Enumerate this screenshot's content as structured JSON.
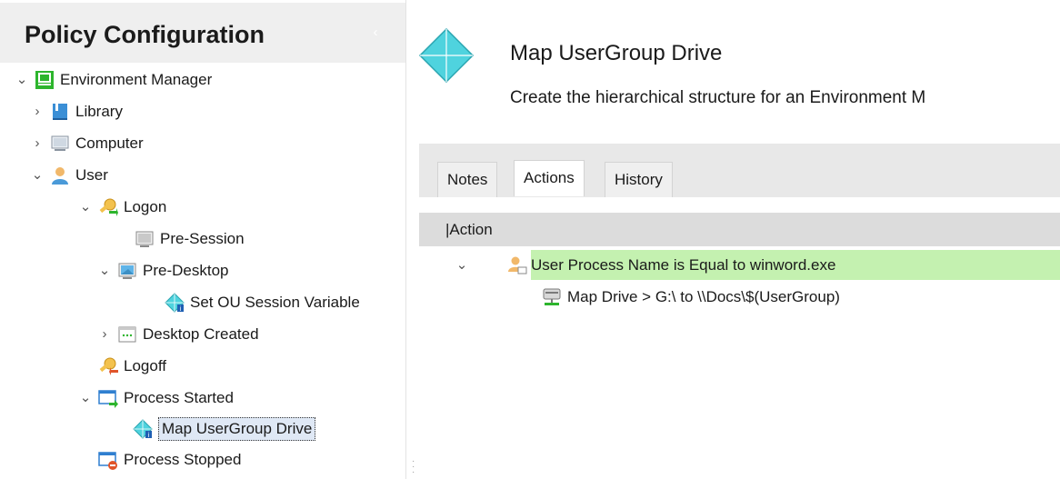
{
  "left_panel": {
    "title": "Policy Configuration",
    "collapse_glyph": "‹",
    "tree": [
      {
        "label": "Environment Manager",
        "icon": "environment-manager-icon",
        "expander": "expanded"
      },
      {
        "label": "Library",
        "icon": "library-icon",
        "expander": "collapsed"
      },
      {
        "label": "Computer",
        "icon": "computer-icon",
        "expander": "collapsed"
      },
      {
        "label": "User",
        "icon": "user-icon",
        "expander": "expanded"
      },
      {
        "label": "Logon",
        "icon": "logon-key-icon",
        "expander": "expanded"
      },
      {
        "label": "Pre-Session",
        "icon": "pre-session-icon",
        "expander": "none"
      },
      {
        "label": "Pre-Desktop",
        "icon": "pre-desktop-icon",
        "expander": "expanded"
      },
      {
        "label": "Set OU Session Variable",
        "icon": "policy-node-icon",
        "expander": "none"
      },
      {
        "label": "Desktop Created",
        "icon": "desktop-created-icon",
        "expander": "collapsed"
      },
      {
        "label": "Logoff",
        "icon": "logoff-key-icon",
        "expander": "none"
      },
      {
        "label": "Process Started",
        "icon": "process-started-icon",
        "expander": "expanded"
      },
      {
        "label": "Map UserGroup Drive",
        "icon": "policy-node-icon",
        "expander": "none",
        "selected": true
      },
      {
        "label": "Process Stopped",
        "icon": "process-stopped-icon",
        "expander": "none"
      }
    ]
  },
  "details": {
    "title": "Map UserGroup Drive",
    "description": "Create the hierarchical structure for an Environment M",
    "tabs": [
      {
        "label": "Notes",
        "active": false
      },
      {
        "label": "Actions",
        "active": true
      },
      {
        "label": "History",
        "active": false
      }
    ],
    "grid": {
      "column_header": "|Action",
      "rows": [
        {
          "text": "User Process Name is Equal to winword.exe",
          "icon": "user-process-condition-icon",
          "expander": "expanded",
          "highlighted": true
        },
        {
          "text": "Map Drive >  G:\\ to \\\\Docs\\$(UserGroup)",
          "icon": "map-drive-icon",
          "expander": "none",
          "highlighted": false
        }
      ]
    }
  },
  "colors": {
    "accent_green": "#2db52d",
    "highlight_row": "#c4f1b0",
    "header_bg": "#efefef",
    "policy_diamond": "#4fd3de"
  }
}
